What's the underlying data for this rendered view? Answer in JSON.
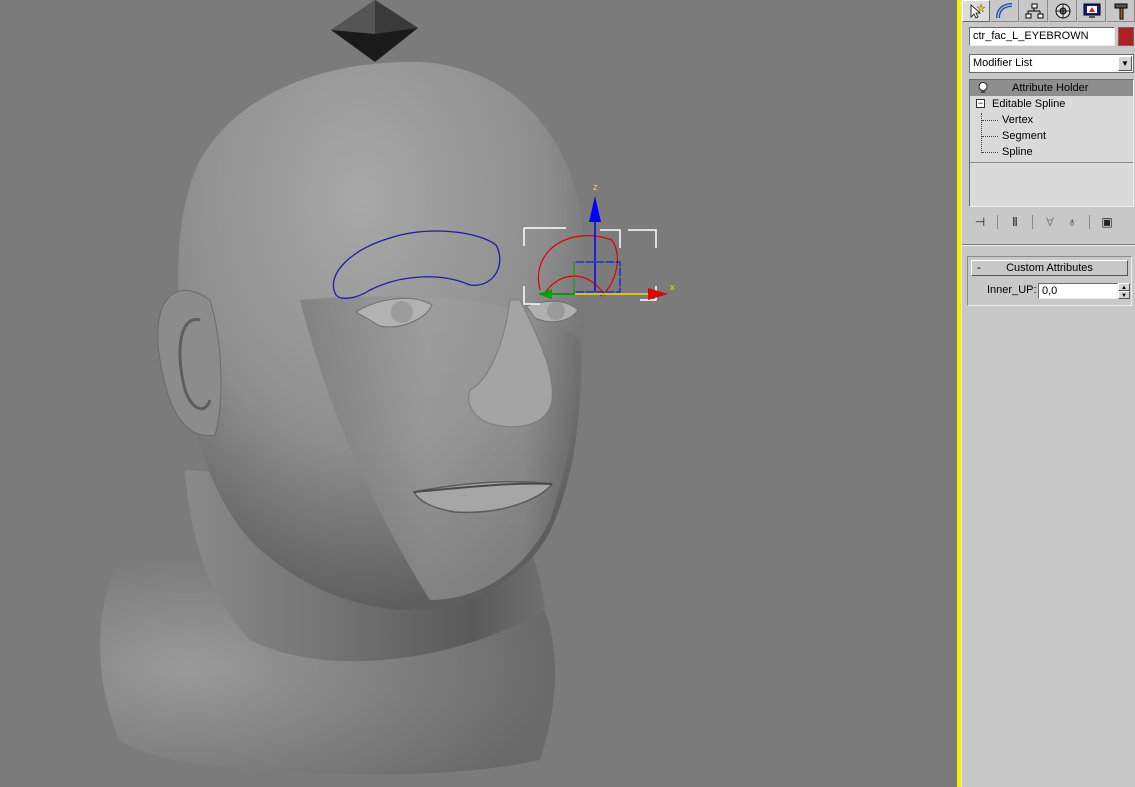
{
  "viewport": {
    "gizmo_axis_x": "x",
    "gizmo_axis_z": "z",
    "colors": {
      "background": "#7b7b7b",
      "spline": "#1c1ca8",
      "axis_x": "#e00000",
      "axis_y": "#00a000",
      "axis_z": "#0000ff",
      "axis_label": "#f0e000"
    }
  },
  "command_panel": {
    "tabs": [
      {
        "name": "create-tab",
        "icon": "cursor-star-icon"
      },
      {
        "name": "modify-tab",
        "icon": "bent-tube-icon"
      },
      {
        "name": "hierarchy-tab",
        "icon": "hierarchy-icon"
      },
      {
        "name": "motion-tab",
        "icon": "motion-wheel-icon"
      },
      {
        "name": "display-tab",
        "icon": "monitor-icon"
      },
      {
        "name": "utilities-tab",
        "icon": "hammer-icon"
      }
    ],
    "object_name": "ctr_fac_L_EYEBROWN",
    "object_color": "#b32020",
    "modifier_list": "Modifier List",
    "stack": {
      "modifier": "Attribute Holder",
      "base_object": "Editable Spline",
      "sub_objects": [
        "Vertex",
        "Segment",
        "Spline"
      ]
    },
    "rollout": {
      "toggle": "-",
      "title": "Custom Attributes",
      "param_label": "Inner_UP:",
      "param_value": "0,0"
    }
  }
}
